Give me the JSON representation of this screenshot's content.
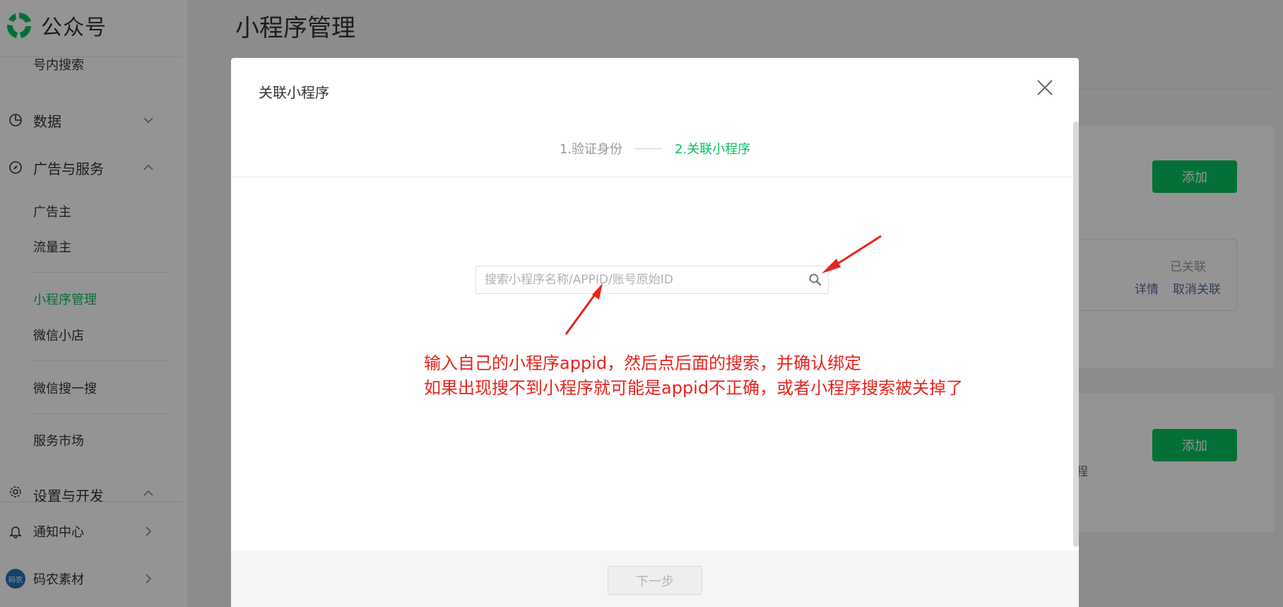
{
  "app": {
    "name": "公众号"
  },
  "sidebar": {
    "top_item": "号内搜索",
    "sections": [
      {
        "label": "数据",
        "icon": "chart-icon",
        "expanded": false
      },
      {
        "label": "广告与服务",
        "icon": "compass-icon",
        "expanded": true
      },
      {
        "label": "设置与开发",
        "icon": "gear-icon",
        "expanded": true
      }
    ],
    "ad_items": [
      "广告主",
      "流量主"
    ],
    "service_items": [
      "小程序管理",
      "微信小店",
      "微信搜一搜",
      "服务市场"
    ],
    "bottom_items": [
      {
        "label": "通知中心",
        "icon": "bell-icon"
      },
      {
        "label": "码农素材",
        "icon": "avatar-icon"
      }
    ],
    "avatar_text": "码农"
  },
  "main": {
    "title": "小程序管理",
    "card1": {
      "add_label": "添加",
      "status": "已关联",
      "detail_link": "详情",
      "unlink_link": "取消关联"
    },
    "card2": {
      "add_label": "添加",
      "partial_text": "程"
    }
  },
  "dialog": {
    "title": "关联小程序",
    "steps": [
      "1.验证身份",
      "2.关联小程序"
    ],
    "active_step": 2,
    "search": {
      "placeholder": "搜索小程序名称/APPID/账号原始ID",
      "value": ""
    },
    "next_label": "下一步"
  },
  "annotation": {
    "line1": "输入自己的小程序appid，然后点后面的搜索，并确认绑定",
    "line2": "如果出现搜不到小程序就可能是appid不正确，或者小程序搜索被关掉了",
    "color": "#e8231d"
  },
  "colors": {
    "brand_green": "#07c160"
  }
}
